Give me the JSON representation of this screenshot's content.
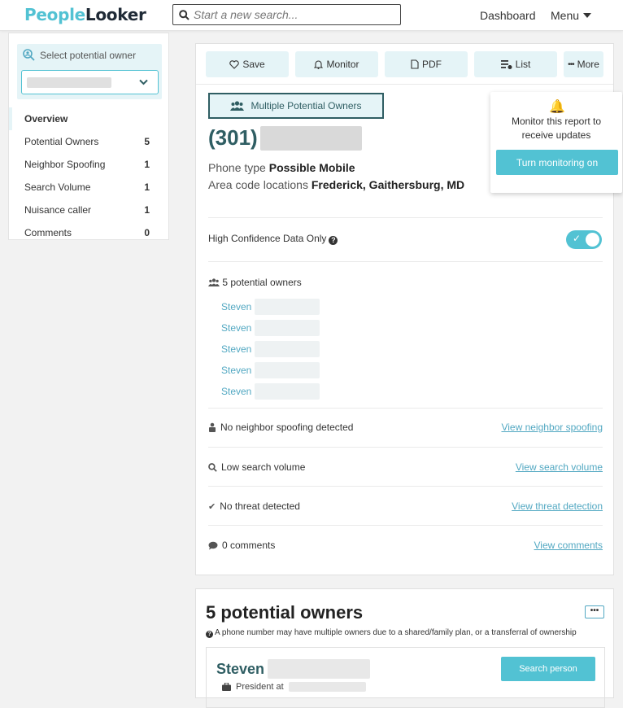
{
  "header": {
    "logo_part1": "People",
    "logo_part2": "Looker",
    "search_placeholder": "Start a new search...",
    "dashboard": "Dashboard",
    "menu": "Menu"
  },
  "sidebar": {
    "select_label": "Select potential owner",
    "items": [
      {
        "label": "Overview",
        "count": ""
      },
      {
        "label": "Potential Owners",
        "count": "5"
      },
      {
        "label": "Neighbor Spoofing",
        "count": "1"
      },
      {
        "label": "Search Volume",
        "count": "1"
      },
      {
        "label": "Nuisance caller",
        "count": "1"
      },
      {
        "label": "Comments",
        "count": "0"
      }
    ]
  },
  "actions": {
    "save": "Save",
    "monitor": "Monitor",
    "pdf": "PDF",
    "list": "List",
    "more": "More"
  },
  "report": {
    "multi_owner_badge": "Multiple Potential Owners",
    "phone_prefix": "(301)",
    "phone_type_label": "Phone type",
    "phone_type_value": "Possible Mobile",
    "area_code_label": "Area code locations",
    "area_code_value": "Frederick, Gaithersburg, MD",
    "high_confidence": "High Confidence Data Only",
    "potential_owners_count": "5 potential owners",
    "owners": [
      "Steven",
      "Steven",
      "Steven",
      "Steven",
      "Steven"
    ],
    "rows": [
      {
        "status": "No neighbor spoofing detected",
        "link": "View neighbor spoofing"
      },
      {
        "status": "Low search volume",
        "link": "View search volume"
      },
      {
        "status": "No threat detected",
        "link": "View threat detection"
      },
      {
        "status": "0 comments",
        "link": "View comments"
      }
    ]
  },
  "popover": {
    "text_line1": "Monitor this report to",
    "text_line2": "receive updates",
    "button": "Turn monitoring on"
  },
  "owners_section": {
    "title": "5 potential owners",
    "note": "A phone number may have multiple owners due to a shared/family plan, or a transferral of ownership",
    "more": "•••",
    "person_first_name": "Steven",
    "person_job_prefix": "President at",
    "search_person": "Search person"
  },
  "colors": {
    "accent": "#52c2d3",
    "dark_teal": "#2f5e63",
    "light_teal_bg": "#e5f4f7",
    "link": "#52a8c2"
  }
}
